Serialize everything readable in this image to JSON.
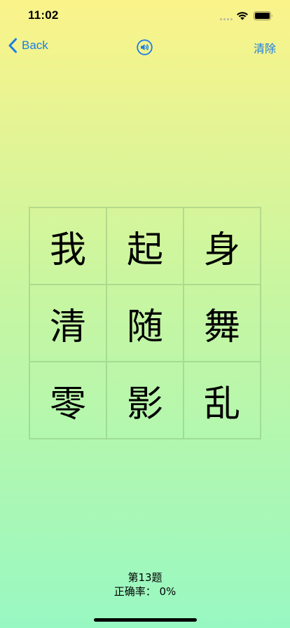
{
  "status_bar": {
    "time": "11:02"
  },
  "nav": {
    "back_label": "Back",
    "speaker_icon": "speaker-wave-icon",
    "clear_label": "清除"
  },
  "grid": {
    "cells": [
      "我",
      "起",
      "身",
      "清",
      "随",
      "舞",
      "零",
      "影",
      "乱"
    ]
  },
  "footer": {
    "question": "第13题",
    "accuracy": "正确率： 0%"
  },
  "colors": {
    "accent": "#1a7de6",
    "bg_top": "#fbf38a",
    "bg_bottom": "#98f8c2"
  }
}
